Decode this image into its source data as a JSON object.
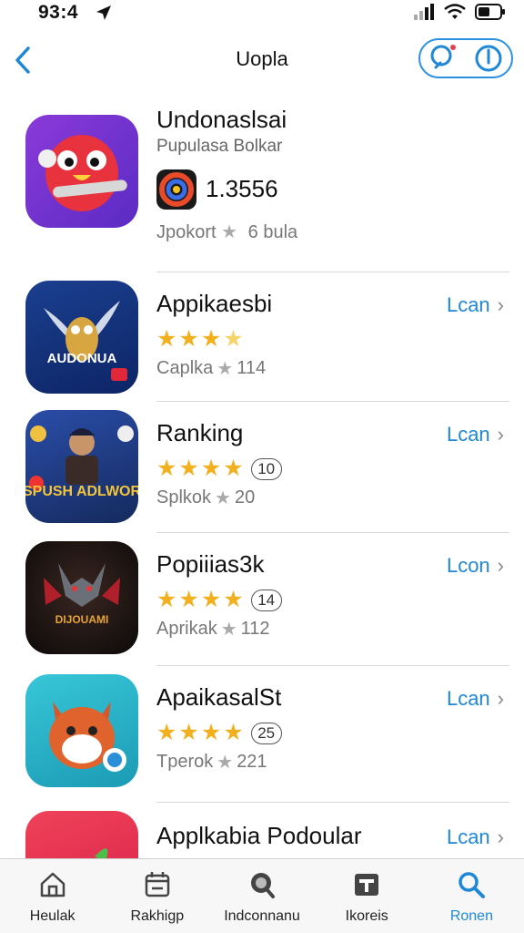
{
  "status_bar": {
    "time": "93:4"
  },
  "nav": {
    "title": "Uopla"
  },
  "featured": {
    "name": "Undonaslsai",
    "subtitle": "Pupulasa  Bolkar",
    "score": "1.3556",
    "meta": "Jpokort",
    "meta_count": "6 bula",
    "icon": "red-bird-icon"
  },
  "apps": [
    {
      "name": "Appikaesbi",
      "stars": 4,
      "badge": "",
      "meta_label": "Caplka",
      "meta_count": "114",
      "link_label": "Lcan",
      "icon": "owl-icon",
      "icon_text": "AUDONUA"
    },
    {
      "name": "Ranking",
      "stars": 4,
      "badge": "10",
      "meta_label": "Splkok",
      "meta_count": "20",
      "link_label": "Lcan",
      "icon": "game-character-icon",
      "icon_text": "SPUSH ADLWOR"
    },
    {
      "name": "Popiiias3k",
      "stars": 4,
      "badge": "14",
      "meta_label": "Aprikak",
      "meta_count": "112",
      "link_label": "Lcon",
      "icon": "demon-icon",
      "icon_text": "DIJOUAMI"
    },
    {
      "name": "ApaikasalSt",
      "stars": 4,
      "badge": "25",
      "meta_label": "Tperok",
      "meta_count": "221",
      "link_label": "Lcan",
      "icon": "fox-icon",
      "icon_text": ""
    },
    {
      "name": "Applkabia Podoular",
      "stars": 0,
      "badge": "",
      "meta_label": "",
      "meta_count": "",
      "link_label": "Lcan",
      "icon": "green-creature-icon",
      "icon_text": ""
    }
  ],
  "tabs": [
    {
      "label": "Heulak",
      "icon": "home-icon",
      "active": false
    },
    {
      "label": "Rakhigp",
      "icon": "calendar-icon",
      "active": false
    },
    {
      "label": "Indconnanu",
      "icon": "search-alt-icon",
      "active": false
    },
    {
      "label": "Ikoreis",
      "icon": "photo-icon",
      "active": false
    },
    {
      "label": "Ronen",
      "icon": "search-icon",
      "active": true
    }
  ],
  "colors": {
    "accent": "#1f88d6",
    "star": "#f2b01e"
  }
}
